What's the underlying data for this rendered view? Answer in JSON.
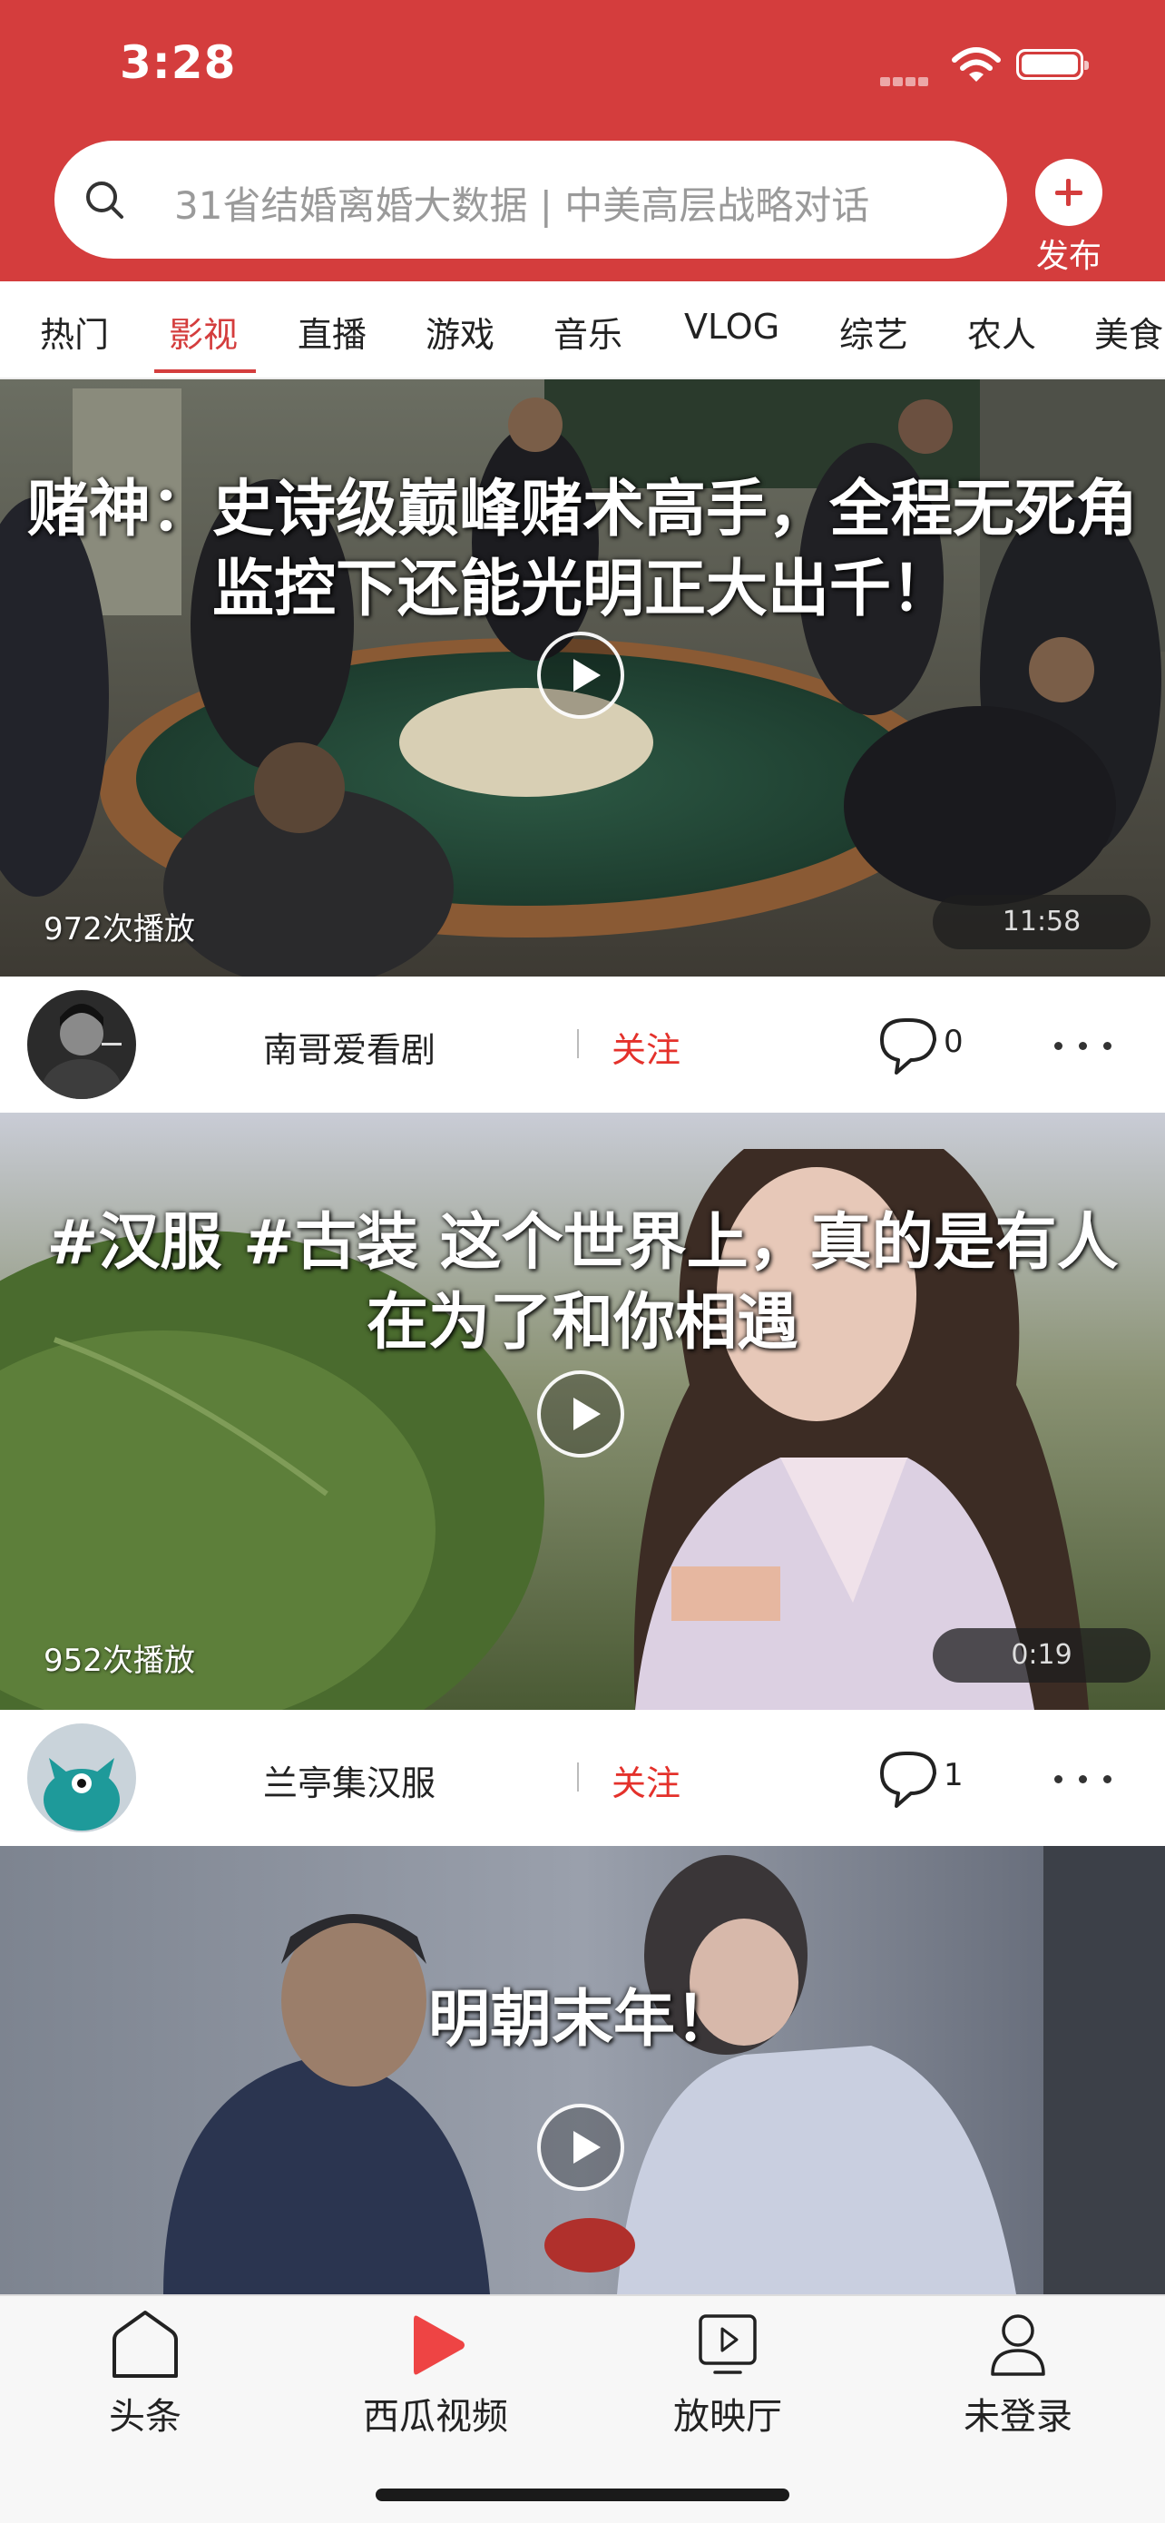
{
  "status_bar": {
    "time": "3:28"
  },
  "search": {
    "placeholder": "31省结婚离婚大数据 | 中美高层战略对话"
  },
  "publish": {
    "label": "发布"
  },
  "tabs": [
    {
      "label": "热门"
    },
    {
      "label": "影视",
      "active": true
    },
    {
      "label": "直播"
    },
    {
      "label": "游戏"
    },
    {
      "label": "音乐"
    },
    {
      "label": "VLOG"
    },
    {
      "label": "综艺"
    },
    {
      "label": "农人"
    },
    {
      "label": "美食"
    }
  ],
  "feed": [
    {
      "title": "赌神：史诗级巅峰赌术高手，全程无死角监控下还能光明正大出千！",
      "plays": "972次播放",
      "duration": "11:58",
      "author": "南哥爱看剧",
      "follow_label": "关注",
      "comments": "0"
    },
    {
      "title": "#汉服 #古装 这个世界上，真的是有人在为了和你相遇",
      "plays": "952次播放",
      "duration": "0:19",
      "author": "兰亭集汉服",
      "follow_label": "关注",
      "comments": "1"
    },
    {
      "title": "明朝末年！"
    }
  ],
  "bottom_nav": [
    {
      "label": "头条",
      "icon": "home-icon"
    },
    {
      "label": "西瓜视频",
      "icon": "play-triangle-icon",
      "active": true
    },
    {
      "label": "放映厅",
      "icon": "tv-icon"
    },
    {
      "label": "未登录",
      "icon": "user-icon"
    }
  ],
  "colors": {
    "brand": "#d43d3d",
    "follow": "#e4312b",
    "active_tab": "#d43d3d"
  }
}
